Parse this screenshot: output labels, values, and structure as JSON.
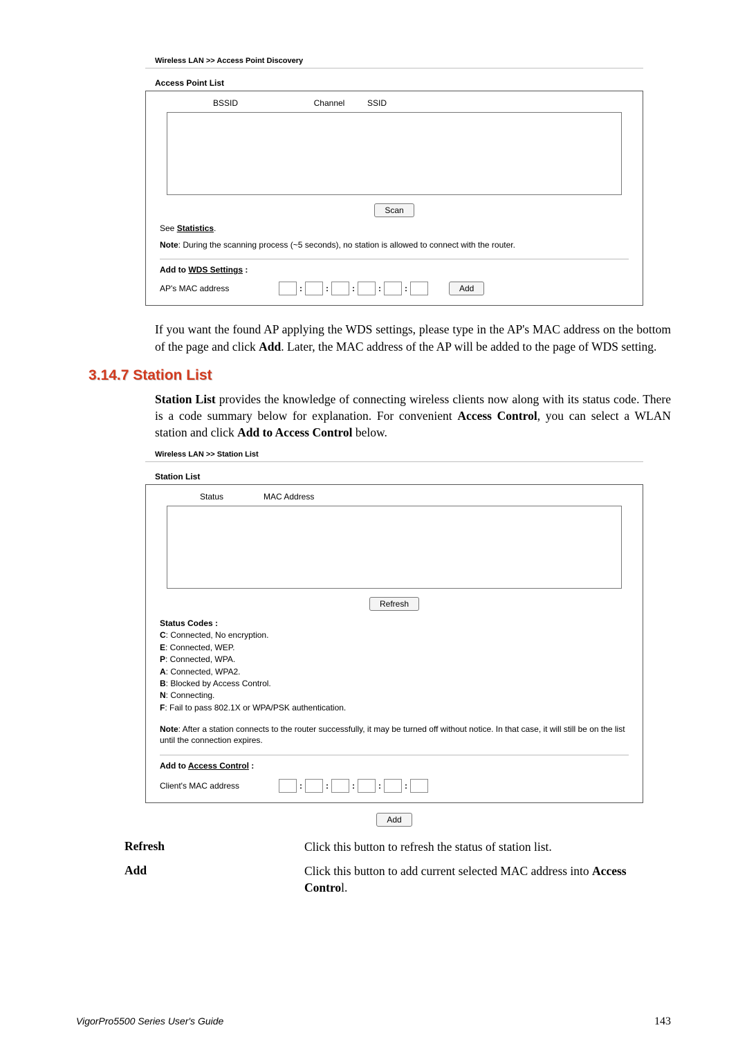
{
  "apd": {
    "breadcrumb": "Wireless LAN >> Access Point Discovery",
    "panel_title": "Access Point List",
    "headers": {
      "bssid": "BSSID",
      "channel": "Channel",
      "ssid": "SSID"
    },
    "scan_label": "Scan",
    "see_text": "See ",
    "statistics_link": "Statistics",
    "see_after": ".",
    "note_prefix": "Note",
    "note_text": ": During the scanning process (~5 seconds), no station is allowed to connect with the router.",
    "add_to_prefix": "Add to ",
    "wds_link": "WDS Settings",
    "add_to_suffix": " :",
    "mac_label": "AP's MAC address",
    "add_label": "Add"
  },
  "para1": "If you want the found AP applying the WDS settings, please type in the AP's MAC address on the bottom of the page and click Add. Later, the MAC address of the AP will be added to the page of WDS setting.",
  "section_heading": "3.14.7 Station List",
  "para2_a": "Station List",
  "para2_b": " provides the knowledge of connecting wireless clients now along with its status code. There is a code summary below for explanation. For convenient ",
  "para2_c": "Access Control",
  "para2_d": ", you can select a WLAN station and click ",
  "para2_e": "Add to Access Control",
  "para2_f": " below.",
  "sl": {
    "breadcrumb": "Wireless LAN >> Station List",
    "panel_title": "Station List",
    "headers": {
      "status": "Status",
      "mac": "MAC Address"
    },
    "refresh_label": "Refresh",
    "codes_title": "Status Codes :",
    "codes": {
      "c": "C: Connected, No encryption.",
      "e": "E: Connected, WEP.",
      "p": "P: Connected, WPA.",
      "a": "A: Connected, WPA2.",
      "b": "B: Blocked by Access Control.",
      "n": "N: Connecting.",
      "f": "F: Fail to pass 802.1X or WPA/PSK authentication."
    },
    "note_prefix": "Note",
    "note_text": ": After a station connects to the router successfully, it may be turned off without notice. In that case, it will still be on the list until the connection expires.",
    "add_to_prefix": "Add to ",
    "access_link": "Access Control",
    "add_to_suffix": " :",
    "mac_label": "Client's MAC address",
    "add_label": "Add"
  },
  "desc": {
    "refresh_term": "Refresh",
    "refresh_def": "Click this button to refresh the status of station list.",
    "add_term": "Add",
    "add_def_a": "Click this button to add current selected MAC address into ",
    "add_def_b": "Access Contro",
    "add_def_c": "l."
  },
  "footer": {
    "guide": "VigorPro5500 Series User's Guide",
    "page": "143"
  }
}
